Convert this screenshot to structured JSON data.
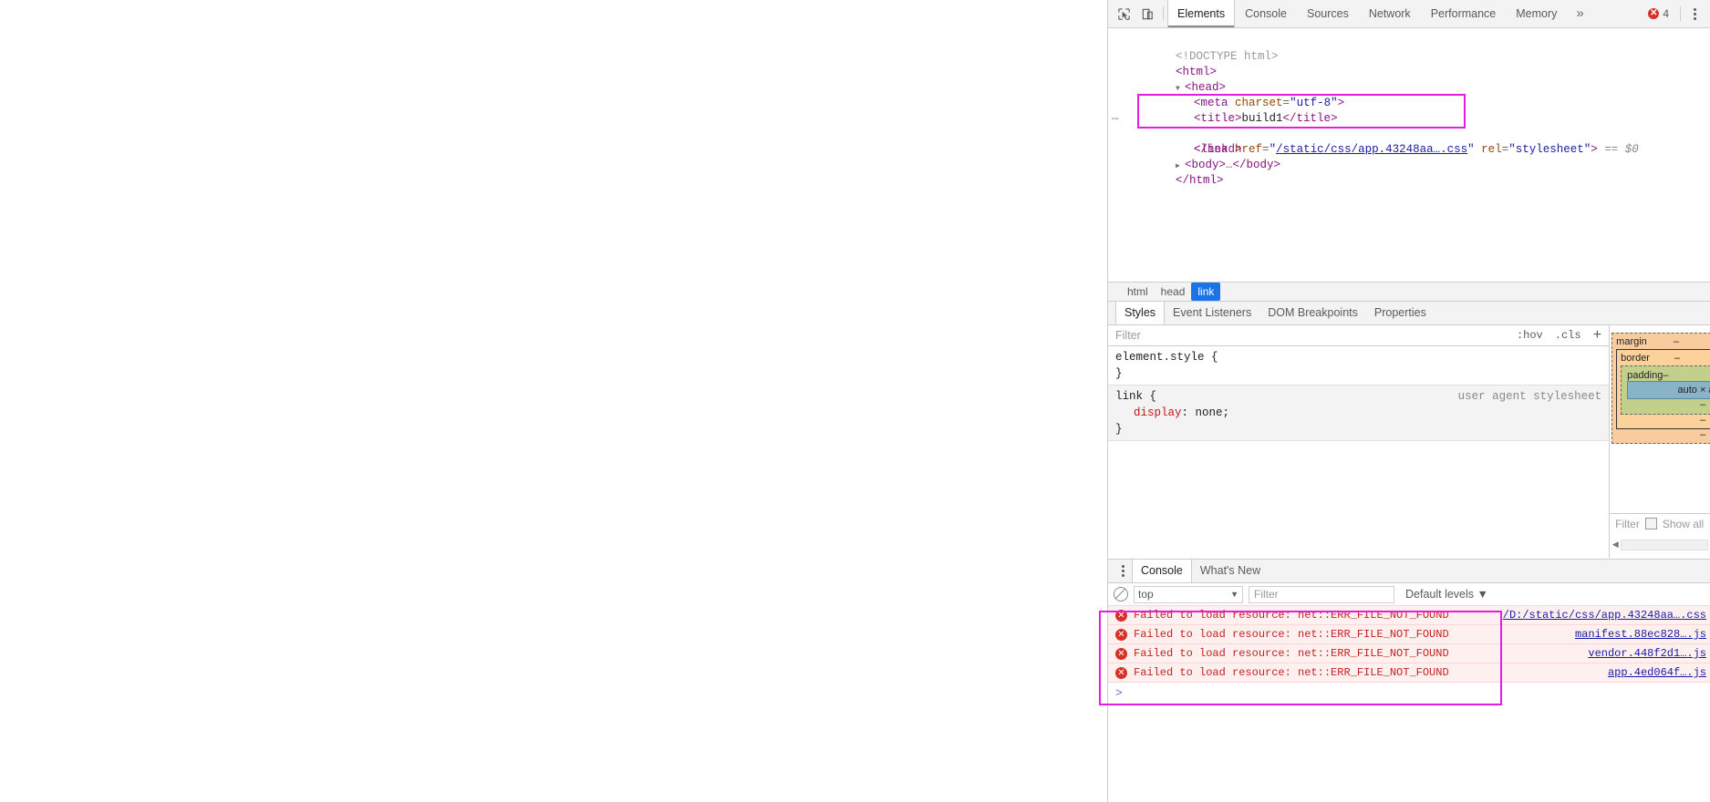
{
  "window": {
    "page_area_label": "blank-page-content"
  },
  "devtools": {
    "toolbar": {
      "inspect_icon": "inspect-cursor-icon",
      "device_icon": "device-toolbar-icon",
      "tabs": [
        {
          "label": "Elements",
          "active": true
        },
        {
          "label": "Console",
          "active": false
        },
        {
          "label": "Sources",
          "active": false
        },
        {
          "label": "Network",
          "active": false
        },
        {
          "label": "Performance",
          "active": false
        },
        {
          "label": "Memory",
          "active": false
        }
      ],
      "more_tabs": "»",
      "error_count": "4",
      "error_icon": "✕",
      "menu_icon": "kebab-menu-icon"
    },
    "dom": {
      "lines": [
        {
          "indent": 0,
          "text": "<!DOCTYPE html>",
          "kind": "doctype"
        },
        {
          "indent": 0,
          "text": "<html>",
          "kind": "tag"
        },
        {
          "indent": 0,
          "text": "<head>",
          "kind": "tag",
          "twisty": "▼"
        },
        {
          "indent": 1,
          "text": "<meta charset=\"utf-8\">",
          "kind": "tag"
        },
        {
          "indent": 1,
          "text": "<title>build1</title>",
          "kind": "tag"
        },
        {
          "indent": 1,
          "text": "<link href=\"/static/css/app.43248aa….css\" rel=\"stylesheet\"> == $0",
          "kind": "tag"
        },
        {
          "indent": 1,
          "text": "</head>",
          "kind": "tag"
        },
        {
          "indent": 0,
          "text": "<body>…</body>",
          "kind": "tag",
          "twisty": "▶"
        },
        {
          "indent": 0,
          "text": "</html>",
          "kind": "tag"
        }
      ],
      "title_tag_name": "title",
      "title_value": "build1",
      "link_tag_name": "link",
      "link_attr_href": "href",
      "link_href_value": "/static/css/app.43248aa….css",
      "link_attr_rel": "rel",
      "link_rel_value": "stylesheet",
      "link_suffix": "== $0",
      "ellipsis_badge": "…",
      "meta_line": "<meta charset=\"utf-8\">",
      "doctype_line": "<!DOCTYPE html>",
      "html_open": "<html>",
      "head_open": "<head>",
      "head_close": "</head>",
      "body_line": "<body>…</body>",
      "html_close": "</html>"
    },
    "breadcrumb": [
      {
        "label": "html",
        "selected": false
      },
      {
        "label": "head",
        "selected": false
      },
      {
        "label": "link",
        "selected": true
      }
    ],
    "styles_pane": {
      "tabs": [
        {
          "label": "Styles",
          "active": true
        },
        {
          "label": "Event Listeners",
          "active": false
        },
        {
          "label": "DOM Breakpoints",
          "active": false
        },
        {
          "label": "Properties",
          "active": false
        }
      ],
      "filter_placeholder": "Filter",
      "hov": ":hov",
      "cls": ".cls",
      "new_rule": "+",
      "rules": [
        {
          "selector": "element.style {",
          "close": "}",
          "source": "",
          "declarations": []
        },
        {
          "selector": "link {",
          "close": "}",
          "source": "user agent stylesheet",
          "declarations": [
            {
              "property": "display",
              "value": "none;"
            }
          ]
        }
      ]
    },
    "box_model": {
      "margin_label": "margin",
      "margin_value": "–",
      "border_label": "border",
      "border_value": "–",
      "padding_label": "padding",
      "padding_value": "–",
      "content_value": "auto × auto",
      "dashes": [
        "–",
        "–",
        "–",
        "–"
      ]
    },
    "computed": {
      "filter_placeholder": "Filter",
      "show_all_label": "Show all"
    },
    "console_drawer": {
      "tabs": [
        {
          "label": "Console",
          "active": true
        },
        {
          "label": "What's New",
          "active": false
        }
      ],
      "clear_icon": "clear-console-icon",
      "context": "top",
      "context_caret": "▼",
      "filter_placeholder": "Filter",
      "levels_label": "Default levels",
      "levels_caret": "▼",
      "prompt": ">",
      "messages": [
        {
          "icon": "✕",
          "text": "Failed to load resource: net::ERR_FILE_NOT_FOUND",
          "source": "/D:/static/css/app.43248aa….css"
        },
        {
          "icon": "✕",
          "text": "Failed to load resource: net::ERR_FILE_NOT_FOUND",
          "source": "manifest.88ec828….js"
        },
        {
          "icon": "✕",
          "text": "Failed to load resource: net::ERR_FILE_NOT_FOUND",
          "source": "vendor.448f2d1….js"
        },
        {
          "icon": "✕",
          "text": "Failed to load resource: net::ERR_FILE_NOT_FOUND",
          "source": "app.4ed064f….js"
        }
      ]
    },
    "annotations": {
      "highlight_color": "#e11ee1",
      "dom_highlight_name": "title-link-highlight",
      "console_highlight_name": "console-errors-highlight"
    }
  }
}
